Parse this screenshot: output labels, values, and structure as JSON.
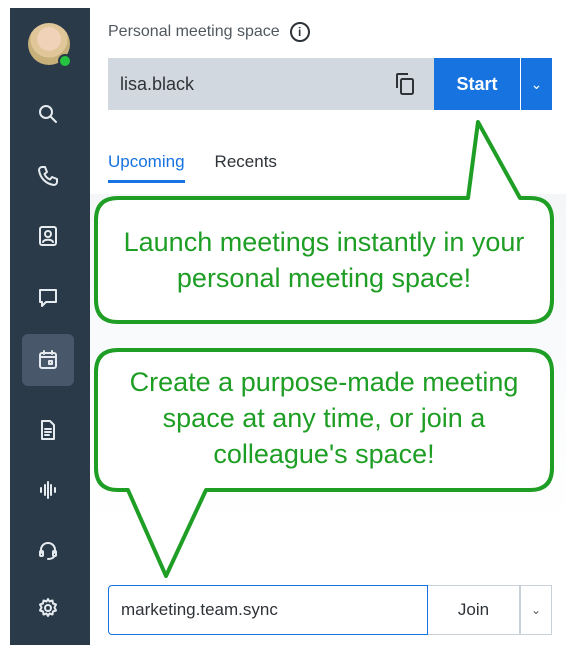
{
  "sidebar": {
    "items": [
      {
        "icon": "search-icon"
      },
      {
        "icon": "phone-icon"
      },
      {
        "icon": "contacts-icon"
      },
      {
        "icon": "chat-icon"
      },
      {
        "icon": "calendar-icon",
        "active": true
      },
      {
        "icon": "document-icon"
      },
      {
        "icon": "voicemail-icon"
      },
      {
        "icon": "headset-icon"
      },
      {
        "icon": "gear-icon"
      }
    ]
  },
  "meeting": {
    "title": "Personal meeting space",
    "space_name": "lisa.black",
    "start_label": "Start",
    "tabs": [
      "Upcoming",
      "Recents"
    ],
    "active_tab": "Upcoming",
    "join_value": "marketing.team.sync",
    "join_label": "Join"
  },
  "callouts": {
    "top": "Launch meetings instantly in your personal meeting space!",
    "bottom": "Create a purpose-made meeting space at any time, or join a colleague's space!"
  },
  "colors": {
    "accent": "#1673e0",
    "callout": "#1f9e25",
    "rail": "#2b3a48"
  }
}
